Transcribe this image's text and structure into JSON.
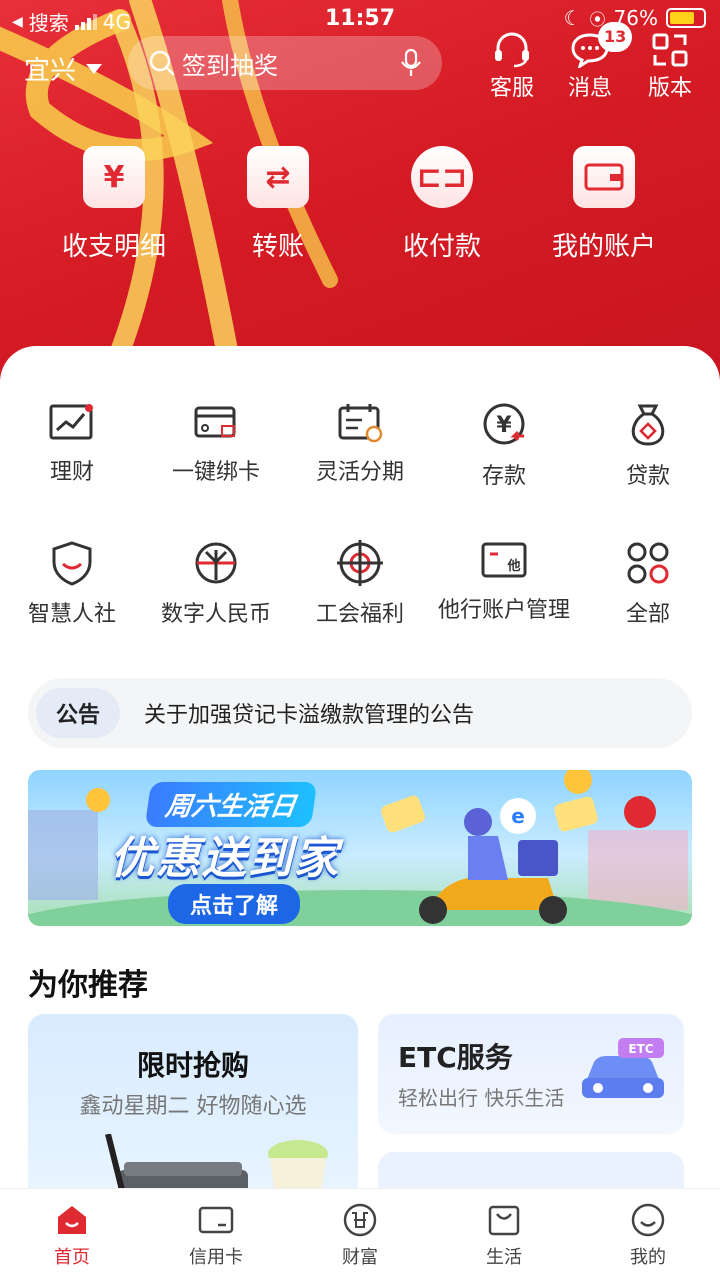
{
  "status_bar": {
    "back_app": "搜索",
    "network": "4G",
    "time": "11:57",
    "battery": "76%",
    "battery_level": 0.76
  },
  "top_bar": {
    "city": "宜兴",
    "search_placeholder": "签到抽奖",
    "actions": [
      {
        "label": "客服",
        "icon": "headset-icon"
      },
      {
        "label": "消息",
        "icon": "message-icon",
        "badge": "13"
      },
      {
        "label": "版本",
        "icon": "switch-version-icon"
      }
    ]
  },
  "quick_actions": [
    {
      "label": "收支明细",
      "icon": "statement-icon"
    },
    {
      "label": "转账",
      "icon": "transfer-icon"
    },
    {
      "label": "收付款",
      "icon": "scan-pay-icon"
    },
    {
      "label": "我的账户",
      "icon": "wallet-icon"
    }
  ],
  "services": [
    {
      "label": "理财",
      "icon": "chart-icon"
    },
    {
      "label": "一键绑卡",
      "icon": "bind-card-icon"
    },
    {
      "label": "灵活分期",
      "icon": "installment-icon"
    },
    {
      "label": "存款",
      "icon": "deposit-icon"
    },
    {
      "label": "贷款",
      "icon": "loan-bag-icon"
    },
    {
      "label": "智慧人社",
      "icon": "shield-smile-icon"
    },
    {
      "label": "数字人民币",
      "icon": "digital-rmb-icon"
    },
    {
      "label": "工会福利",
      "icon": "union-icon"
    },
    {
      "label": "他行账户管理",
      "icon": "other-bank-card-icon"
    },
    {
      "label": "全部",
      "icon": "all-grid-icon"
    }
  ],
  "notice": {
    "tag": "公告",
    "text": "关于加强贷记卡溢缴款管理的公告"
  },
  "banner": {
    "subtitle": "周六生活日",
    "title": "优惠送到家",
    "cta": "点击了解"
  },
  "recommend": {
    "title": "为你推荐",
    "left_card": {
      "title": "限时抢购",
      "subtitle": "鑫动星期二  好物随心选"
    },
    "right_card": {
      "title": "ETC服务",
      "subtitle": "轻松出行 快乐生活",
      "tag": "ETC"
    }
  },
  "tab_bar": [
    {
      "label": "首页",
      "icon": "home-icon",
      "active": true
    },
    {
      "label": "信用卡",
      "icon": "credit-card-icon",
      "active": false
    },
    {
      "label": "财富",
      "icon": "wealth-icon",
      "active": false
    },
    {
      "label": "生活",
      "icon": "shopping-bag-icon",
      "active": false
    },
    {
      "label": "我的",
      "icon": "profile-smile-icon",
      "active": false
    }
  ],
  "colors": {
    "brand_red": "#e02a32",
    "header_red": "#d61c25"
  }
}
